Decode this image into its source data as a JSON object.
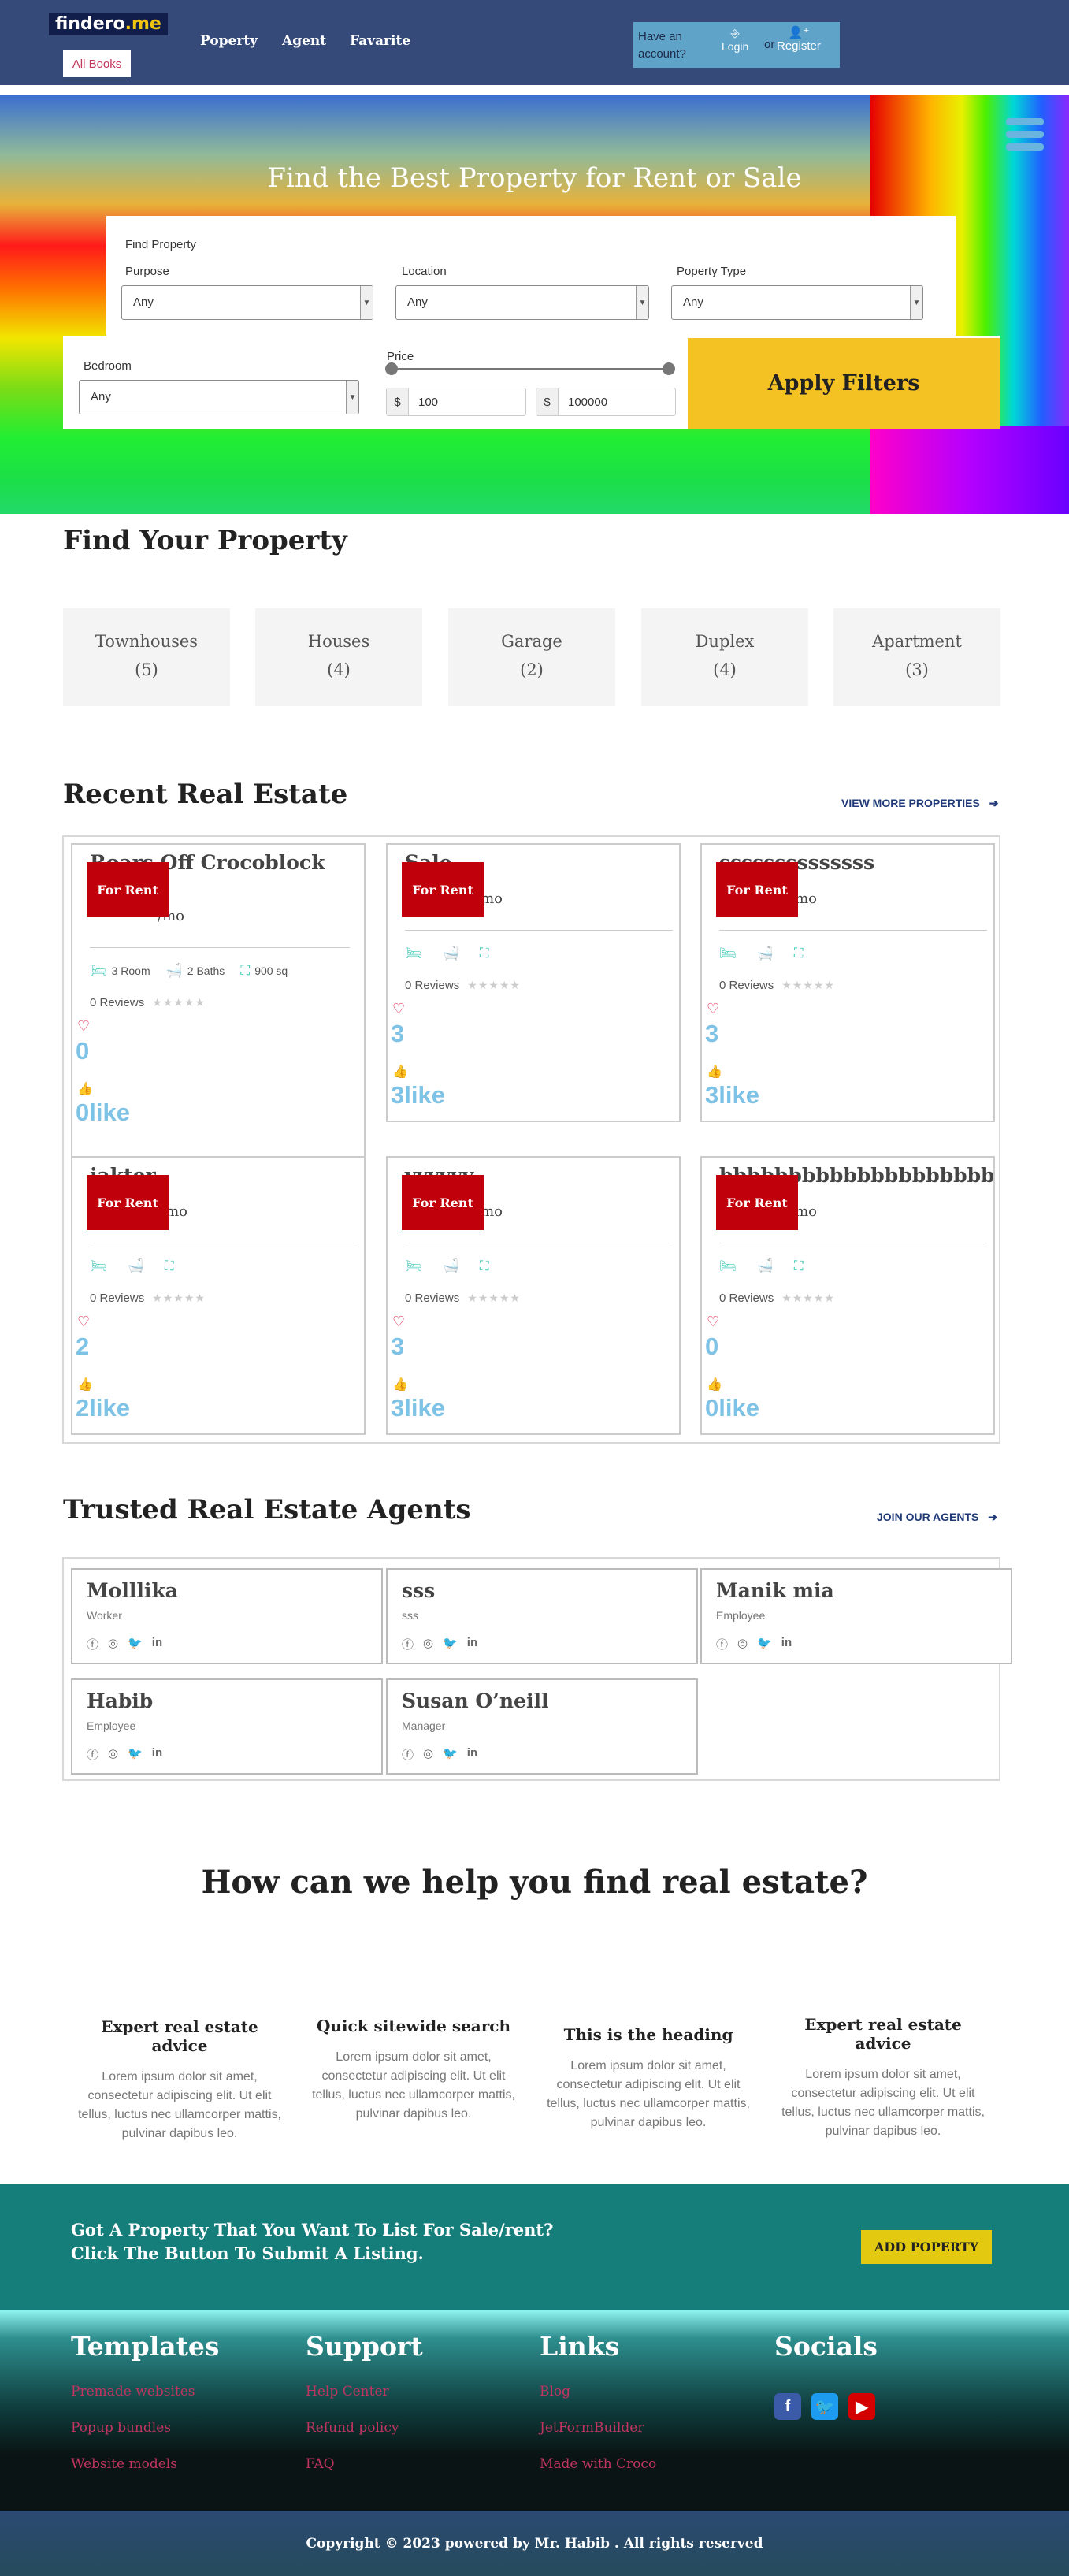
{
  "header": {
    "logo_main": "findero",
    "logo_accent": ".me",
    "all_books": "All Books",
    "nav": [
      "Poperty",
      "Agent",
      "Favarite"
    ],
    "have_account": "Have an account?",
    "login": "Login",
    "or": "or",
    "register": "Register"
  },
  "hero": {
    "title": "Find the Best Property for Rent or Sale",
    "find_label": "Find Property",
    "purpose_label": "Purpose",
    "purpose_value": "Any",
    "location_label": "Location",
    "location_value": "Any",
    "type_label": "Poperty Type",
    "type_value": "Any",
    "bedroom_label": "Bedroom",
    "bedroom_value": "Any",
    "price_label": "Price",
    "currency": "$",
    "price_min": "100",
    "price_max": "100000",
    "apply": "Apply Filters"
  },
  "categories": {
    "heading": "Find Your Property",
    "items": [
      {
        "name": "Townhouses",
        "count": "(5)"
      },
      {
        "name": "Houses",
        "count": "(4)"
      },
      {
        "name": "Garage",
        "count": "(2)"
      },
      {
        "name": "Duplex",
        "count": "(4)"
      },
      {
        "name": "Apartment",
        "count": "(3)"
      }
    ]
  },
  "recent": {
    "heading": "Recent Real Estate",
    "view_more": "VIEW MORE PROPERTIES",
    "badge": "For Rent",
    "mo": "/mo",
    "reviews": "0 Reviews",
    "stars": "★★★★★",
    "cards": [
      {
        "title": "Roars Off Crocoblock",
        "rooms": "3 Room",
        "baths": "2 Baths",
        "area": "900 sq",
        "count": "0",
        "likes": "0like"
      },
      {
        "title": "Sale",
        "rooms": "",
        "baths": "",
        "area": "",
        "count": "3",
        "likes": "3like"
      },
      {
        "title": "ssssssssssssss",
        "rooms": "",
        "baths": "",
        "area": "",
        "count": "3",
        "likes": "3like"
      },
      {
        "title": "iakter",
        "rooms": "",
        "baths": "",
        "area": "",
        "count": "2",
        "likes": "2like"
      },
      {
        "title": "vvvvvv",
        "rooms": "",
        "baths": "",
        "area": "",
        "count": "3",
        "likes": "3like"
      },
      {
        "title": "bbbbbbbbbbbbbbbbbbbbbbb",
        "rooms": "",
        "baths": "",
        "area": "",
        "count": "0",
        "likes": "0like"
      }
    ]
  },
  "agents": {
    "heading": "Trusted Real Estate Agents",
    "join": "JOIN OUR AGENTS",
    "list": [
      {
        "name": "Molllika",
        "role": "Worker"
      },
      {
        "name": "sss",
        "role": "sss"
      },
      {
        "name": "Manik mia",
        "role": "Employee"
      },
      {
        "name": "Habib",
        "role": "Employee"
      },
      {
        "name": "Susan O’neill",
        "role": "Manager"
      }
    ]
  },
  "help": {
    "heading": "How can we help you find real estate?",
    "features": [
      {
        "title": "Expert real estate advice",
        "text": "Lorem ipsum dolor sit amet, consectetur adipiscing elit. Ut elit tellus, luctus nec ullamcorper mattis, pulvinar dapibus leo."
      },
      {
        "title": "Quick sitewide search",
        "text": "Lorem ipsum dolor sit amet, consectetur adipiscing elit. Ut elit tellus, luctus nec ullamcorper mattis, pulvinar dapibus leo."
      },
      {
        "title": "This is the heading",
        "text": "Lorem ipsum dolor sit amet, consectetur adipiscing elit. Ut elit tellus, luctus nec ullamcorper mattis, pulvinar dapibus leo."
      },
      {
        "title": "Expert real estate advice",
        "text": "Lorem ipsum dolor sit amet, consectetur adipiscing elit. Ut elit tellus, luctus nec ullamcorper mattis, pulvinar dapibus leo."
      }
    ]
  },
  "cta": {
    "line1": "Got A Property That You Want To List For Sale/rent?",
    "line2": "Click The Button To Submit A Listing.",
    "button": "ADD POPERTY"
  },
  "footer": {
    "templates": {
      "heading": "Templates",
      "links": [
        "Premade websites",
        "Popup bundles",
        "Website models"
      ]
    },
    "support": {
      "heading": "Support",
      "links": [
        "Help Center",
        "Refund policy",
        "FAQ"
      ]
    },
    "links": {
      "heading": "Links",
      "links": [
        "Blog",
        "JetFormBuilder",
        "Made with Croco"
      ]
    },
    "socials": {
      "heading": "Socials"
    },
    "copyright": "Copyright © 2023 powered by Mr. Habib . All rights reserved"
  },
  "colors": {
    "header_bg": "#354a78",
    "accent_yellow": "#f5c224",
    "badge_red": "#c0000a",
    "cta_teal": "#157d7a",
    "like_blue": "#7ec3e6"
  }
}
